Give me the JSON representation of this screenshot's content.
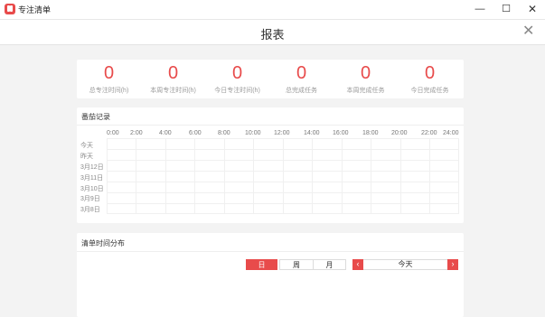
{
  "window": {
    "title": "专注清单",
    "min_glyph": "—",
    "max_glyph": "☐",
    "close_glyph": "✕"
  },
  "header": {
    "title": "报表",
    "close_glyph": "✕"
  },
  "stats": [
    {
      "value": "0",
      "label": "总专注时间(h)"
    },
    {
      "value": "0",
      "label": "本周专注时间(h)"
    },
    {
      "value": "0",
      "label": "今日专注时间(h)"
    },
    {
      "value": "0",
      "label": "总完成任务"
    },
    {
      "value": "0",
      "label": "本周完成任务"
    },
    {
      "value": "0",
      "label": "今日完成任务"
    }
  ],
  "record": {
    "title": "番茄记录",
    "times": [
      "0:00",
      "2:00",
      "4:00",
      "6:00",
      "8:00",
      "10:00",
      "12:00",
      "14:00",
      "16:00",
      "18:00",
      "20:00",
      "22:00",
      "24:00"
    ],
    "days": [
      "今天",
      "昨天",
      "3月12日",
      "3月11日",
      "3月10日",
      "3月9日",
      "3月8日"
    ]
  },
  "distribution": {
    "title": "清单时间分布",
    "tabs": {
      "day": "日",
      "week": "周",
      "month": "月"
    },
    "prev_glyph": "‹",
    "next_glyph": "›",
    "date_label": "今天"
  },
  "colors": {
    "accent": "#e84b4b"
  }
}
